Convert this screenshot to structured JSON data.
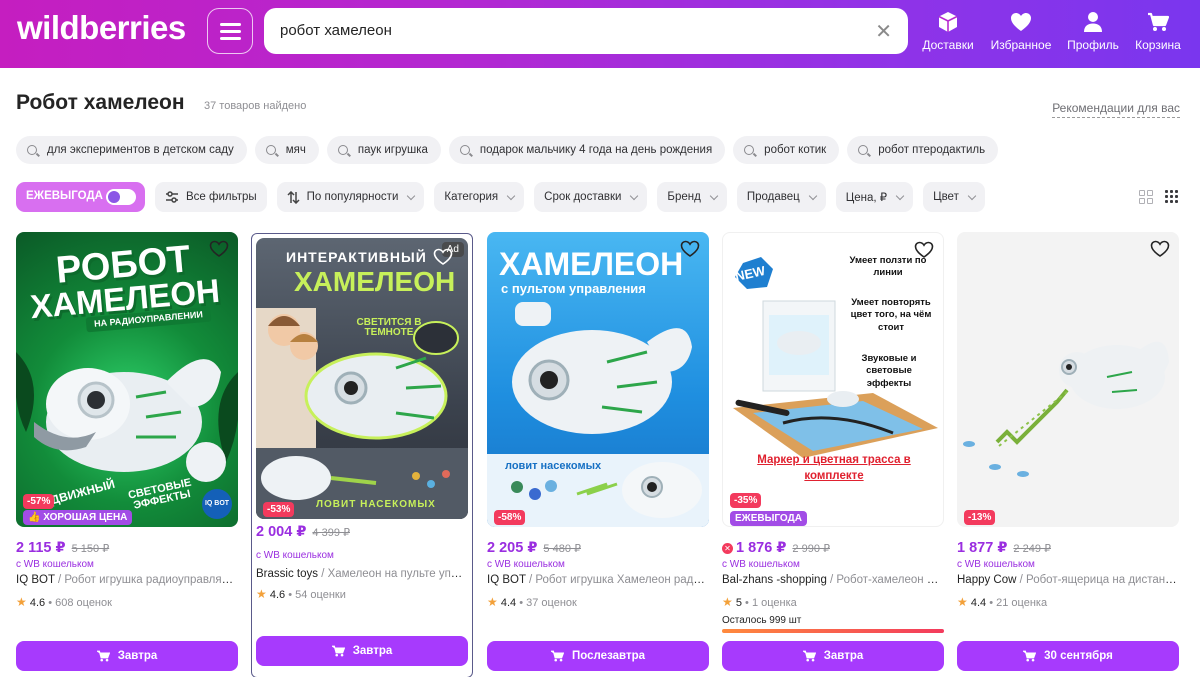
{
  "header": {
    "logo": "wildberries",
    "search_query": "робот хамелеон",
    "nav": [
      {
        "label": "Доставки",
        "icon": "box-icon"
      },
      {
        "label": "Избранное",
        "icon": "heart-icon"
      },
      {
        "label": "Профиль",
        "icon": "user-icon"
      },
      {
        "label": "Корзина",
        "icon": "cart-icon"
      }
    ]
  },
  "page": {
    "title": "Робот хамелеон",
    "count": "37 товаров найдено",
    "recommendations": "Рекомендации для вас"
  },
  "suggestions": [
    "для экспериментов в детском саду",
    "мяч",
    "паук игрушка",
    "подарок мальчику 4 года на день рождения",
    "робот котик",
    "робот птеродактиль"
  ],
  "filters": {
    "profit_toggle": "ЕЖЕВЫГОДА",
    "all_filters": "Все фильтры",
    "sort": "По популярности",
    "dropdowns": [
      "Категория",
      "Срок доставки",
      "Бренд",
      "Продавец",
      "Цена, ₽",
      "Цвет"
    ]
  },
  "products": [
    {
      "discount": "-57%",
      "badge": "ХОРОШАЯ ЦЕНА",
      "price": "2 115 ₽",
      "old_price": "5 150 ₽",
      "wallet": "с WB кошельком",
      "brand": "IQ BOT",
      "desc": " / Робот игрушка радиоуправляемый хамелеон",
      "rating": "4.6",
      "reviews": "608 оценок",
      "delivery": "Завтра",
      "img": {
        "line1": "РОБОТ",
        "line2": "ХАМЕЛЕОН",
        "sub": "НА РАДИОУПРАВЛЕНИИ",
        "left": "ДВИЖНЫЙ",
        "right": "СВЕТОВЫЕ ЭФФЕКТЫ",
        "logo": "IQ BOT"
      }
    },
    {
      "ad": "Ad",
      "discount": "-53%",
      "price": "2 004 ₽",
      "old_price": "4 399 ₽",
      "wallet": "с WB кошельком",
      "brand": "Brassic toys",
      "desc": " / Хамелеон на пульте управления",
      "rating": "4.6",
      "reviews": "54 оценки",
      "delivery": "Завтра",
      "img": {
        "line1": "ИНТЕРАКТИВНЫЙ",
        "line2": "ХАМЕЛЕОН",
        "sub": "СВЕТИТСЯ В ТЕМНОТЕ",
        "bottom": "ЛОВИТ НАСЕКОМЫХ"
      }
    },
    {
      "discount": "-58%",
      "price": "2 205 ₽",
      "old_price": "5 480 ₽",
      "wallet": "с WB кошельком",
      "brand": "IQ BOT",
      "desc": " / Робот игрушка Хамелеон радиоуправляемый",
      "rating": "4.4",
      "reviews": "37 оценок",
      "delivery": "Послезавтра",
      "img": {
        "line1": "ХАМЕЛЕОН",
        "sub": "с пультом управления",
        "bottom": "ловит насекомых"
      }
    },
    {
      "discount": "-35%",
      "badge": "ЕЖЕВЫГОДА",
      "price": "1 876 ₽",
      "old_price": "2 990 ₽",
      "wallet": "с WB кошельком",
      "brand": "Bal-zhans -shopping",
      "desc": " / Робот-хамелеон движущийся",
      "rating": "5",
      "reviews": "1 оценка",
      "stock": "Осталось 999 шт",
      "delivery": "Завтра",
      "img": {
        "new": "NEW",
        "f1": "Умеет ползти по линии",
        "f2": "Умеет повторять цвет того, на чём стоит",
        "f3": "Звуковые и световые эффекты",
        "bottom": "Маркер и цветная трасса в комплекте"
      }
    },
    {
      "discount": "-13%",
      "price": "1 877 ₽",
      "old_price": "2 249 ₽",
      "wallet": "с WB кошельком",
      "brand": "Happy Cow",
      "desc": " / Робот-ящерица на дистанционном управлении",
      "rating": "4.4",
      "reviews": "21 оценка",
      "delivery": "30 сентября",
      "img": {}
    }
  ],
  "colors": {
    "accent": "#a73afd",
    "price": "#9a2ee0",
    "discount": "#f33a5d",
    "header_from": "#c51ec0",
    "header_to": "#7a36ee"
  }
}
